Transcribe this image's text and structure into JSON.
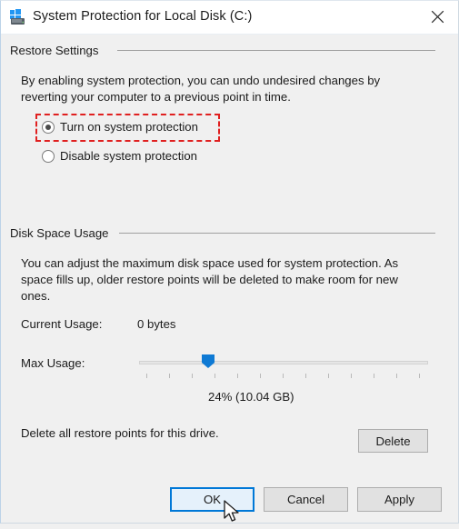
{
  "window": {
    "title": "System Protection for Local Disk (C:)",
    "icon": "system-protection-drive-icon",
    "close_label": "Close",
    "background_color": "#f0f0f0",
    "titlebar_color": "#ffffff"
  },
  "restore_settings": {
    "header": "Restore Settings",
    "description": "By enabling system protection, you can undo undesired changes by reverting your computer to a previous point in time.",
    "options": [
      {
        "label": "Turn on system protection",
        "selected": true
      },
      {
        "label": "Disable system protection",
        "selected": false
      }
    ],
    "annotation": {
      "target": "Turn on system protection",
      "style": "red-dashed-box",
      "color": "#e02020"
    }
  },
  "disk_space_usage": {
    "header": "Disk Space Usage",
    "description": "You can adjust the maximum disk space used for system protection. As space fills up, older restore points will be deleted to make room for new ones.",
    "current_usage_label": "Current Usage:",
    "current_usage_value": "0 bytes",
    "max_usage_label": "Max Usage:",
    "slider": {
      "value_percent": 24,
      "min": 0,
      "max": 100,
      "tick_count": 13,
      "thumb_color": "#0f7ad4"
    },
    "value_text": "24% (10.04 GB)",
    "delete_text": "Delete all restore points for this drive.",
    "delete_button": "Delete"
  },
  "footer": {
    "ok_button": "OK",
    "cancel_button": "Cancel",
    "apply_button": "Apply",
    "focused_button": "OK"
  }
}
